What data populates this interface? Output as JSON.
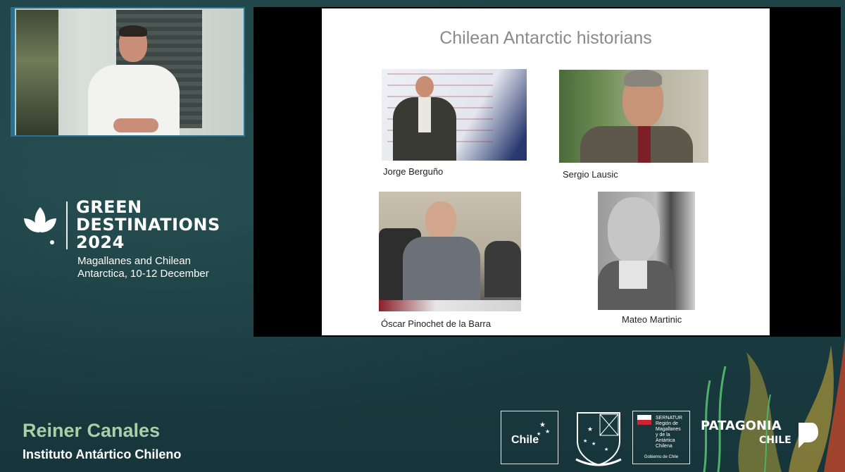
{
  "brand": {
    "title": "GREEN\nDESTINATIONS\n2024",
    "subtitle": "Magallanes and Chilean\nAntarctica, 10-12 December"
  },
  "slide": {
    "title": "Chilean Antarctic historians",
    "captions": [
      "Jorge Berguño",
      "Sergio Lausic",
      "Óscar Pinochet de la Barra",
      "Mateo Martinic"
    ]
  },
  "speaker": {
    "name": "Reiner Canales",
    "organization": "Instituto Antártico Chileno"
  },
  "logos": {
    "chile": "Chile",
    "sernatur": "SERNATUR\nRegión de Magallanes\ny de la Antártica Chilena",
    "gobierno": "Gobierno de Chile",
    "patagonia": "PATAGONIA",
    "patagonia_sub": "CHILE"
  },
  "colors": {
    "accent_green": "#a9cfa6",
    "background": "#1d4146",
    "camera_border": "#2c6f8f"
  }
}
